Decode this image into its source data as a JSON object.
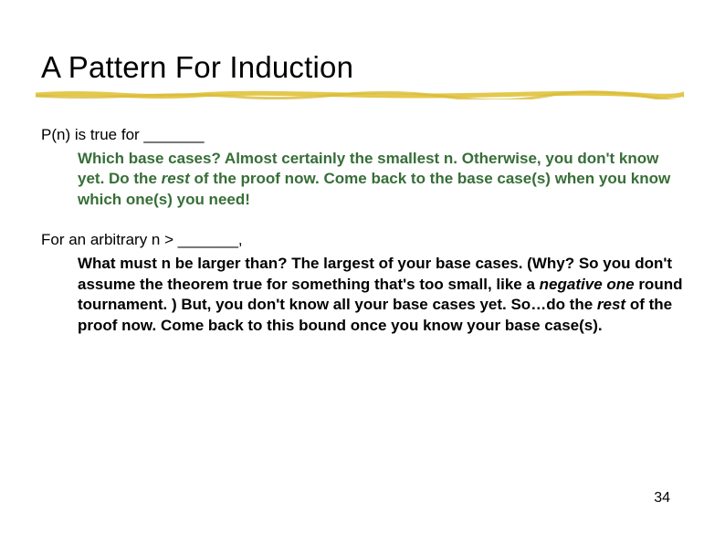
{
  "title": "A Pattern For Induction",
  "section1": {
    "lead": "P(n) is true for _______",
    "sub_part1": "Which base cases?  Almost certainly the smallest n.  Otherwise, you don't know yet.  Do the ",
    "rest1": "rest",
    "sub_part2": " of the proof now. Come back to the base case(s) when you know which one(s) you need!"
  },
  "section2": {
    "lead": "For an arbitrary n > _______,  ",
    "sub_part1": "What must n be larger than?  The largest of your base cases.  (Why?  So you don't assume the theorem true for something that's too small, like a ",
    "neg1": "negative one",
    "sub_part2": " round tournament. )  But, you don't know all your base cases yet.  So…do the ",
    "rest2": "rest",
    "sub_part3": " of the proof now.  Come back to this bound once you know your base case(s)."
  },
  "page_number": "34"
}
